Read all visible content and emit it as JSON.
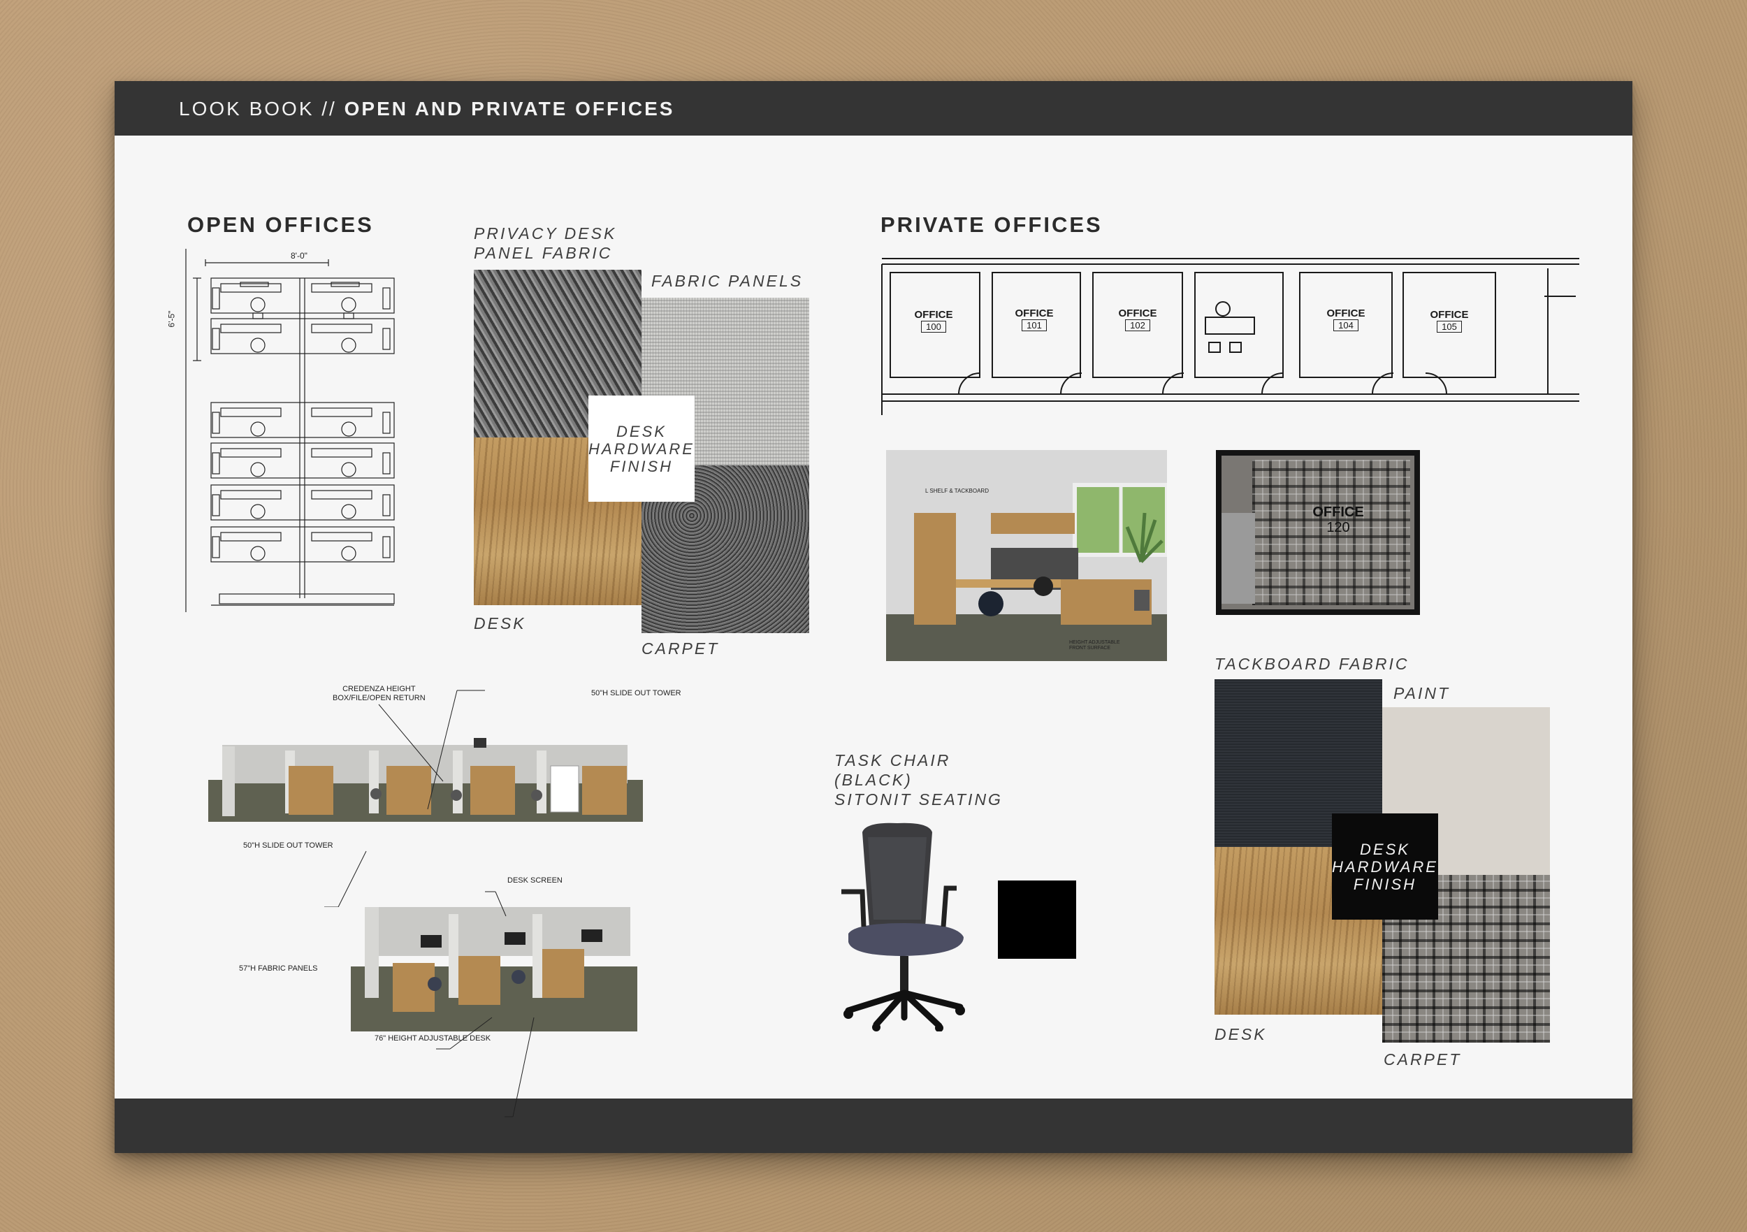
{
  "header": {
    "prefix": "LOOK BOOK // ",
    "title": "OPEN AND PRIVATE OFFICES"
  },
  "open_offices": {
    "title": "OPEN OFFICES",
    "dimension_width": "8'-0\"",
    "dimension_depth": "6'-5\"",
    "labels": {
      "privacy_fabric_l1": "PRIVACY DESK",
      "privacy_fabric_l2": "PANEL FABRIC",
      "fabric_panels": "FABRIC PANELS",
      "finish_l1": "DESK",
      "finish_l2": "HARDWARE",
      "finish_l3": "FINISH",
      "desk": "DESK",
      "carpet": "CARPET"
    },
    "render_callouts": {
      "credenza_l1": "CREDENZA HEIGHT",
      "credenza_l2": "BOX/FILE/OPEN RETURN",
      "slide_tower_top": "50\"H SLIDE OUT TOWER",
      "slide_tower_bottom": "50\"H SLIDE OUT TOWER",
      "desk_screen": "DESK SCREEN",
      "fabric_panels_57": "57\"H FABRIC PANELS",
      "adjustable_desk": "76\" HEIGHT ADJUSTABLE DESK"
    }
  },
  "private_offices": {
    "title": "PRIVATE OFFICES",
    "offices": [
      {
        "label": "OFFICE",
        "number": "100"
      },
      {
        "label": "OFFICE",
        "number": "101"
      },
      {
        "label": "OFFICE",
        "number": "102"
      },
      {
        "label": "OFFICE",
        "number": "104"
      },
      {
        "label": "OFFICE",
        "number": "105"
      }
    ],
    "office_120": {
      "label": "OFFICE",
      "number": "120"
    },
    "photo_callouts": {
      "shelf": "L SHELF & TACKBOARD",
      "height_l1": "HEIGHT ADJUSTABLE",
      "height_l2": "FRONT SURFACE"
    },
    "labels": {
      "tackboard_fabric": "TACKBOARD FABRIC",
      "paint": "PAINT",
      "finish_l1": "DESK",
      "finish_l2": "HARDWARE",
      "finish_l3": "FINISH",
      "desk": "DESK",
      "carpet": "CARPET"
    }
  },
  "task_chair": {
    "line1": "TASK CHAIR",
    "line2": "(BLACK)",
    "line3": "SITONIT SEATING"
  }
}
